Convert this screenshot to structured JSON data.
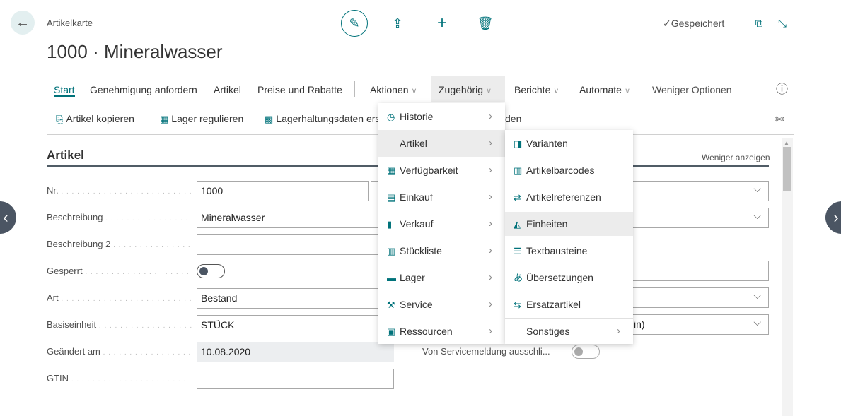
{
  "header": {
    "breadcrumb": "Artikelkarte",
    "title": "1000 · Mineralwasser",
    "status": "Gespeichert"
  },
  "tabs": [
    {
      "label": "Start"
    },
    {
      "label": "Genehmigung anfordern"
    },
    {
      "label": "Artikel"
    },
    {
      "label": "Preise und Rabatte"
    },
    {
      "label": "Aktionen"
    },
    {
      "label": "Zugehörig"
    },
    {
      "label": "Berichte"
    },
    {
      "label": "Automate"
    },
    {
      "label": "Weniger Optionen"
    }
  ],
  "actions": [
    {
      "label": "Artikel kopieren"
    },
    {
      "label": "Lager regulieren"
    },
    {
      "label": "Lagerhaltungsdaten ers"
    },
    {
      "label": "den"
    }
  ],
  "section": {
    "title": "Artikel",
    "toggle": "Weniger anzeigen"
  },
  "fields": [
    {
      "label": "Nr.",
      "value": "1000"
    },
    {
      "label": "Beschreibung",
      "value": "Mineralwasser"
    },
    {
      "label": "Beschreibung 2",
      "value": ""
    },
    {
      "label": "Gesperrt",
      "value": false
    },
    {
      "label": "Art",
      "value": "Bestand"
    },
    {
      "label": "Basiseinheit",
      "value": "STÜCK"
    },
    {
      "label": "Geändert am",
      "value": "10.08.2020"
    },
    {
      "label": "GTIN",
      "value": ""
    }
  ],
  "right_fields": {
    "partial_value": "in)",
    "service_label": "Von Servicemeldung ausschli...",
    "service_value": false
  },
  "menu": [
    {
      "label": "Historie",
      "icon": "history-icon"
    },
    {
      "label": "Artikel",
      "icon": ""
    },
    {
      "label": "Verfügbarkeit",
      "icon": "availability-icon"
    },
    {
      "label": "Einkauf",
      "icon": "purchase-icon"
    },
    {
      "label": "Verkauf",
      "icon": "sales-icon"
    },
    {
      "label": "Stückliste",
      "icon": "bom-icon"
    },
    {
      "label": "Lager",
      "icon": "warehouse-icon"
    },
    {
      "label": "Service",
      "icon": "service-icon"
    },
    {
      "label": "Ressourcen",
      "icon": "resources-icon"
    }
  ],
  "submenu": [
    {
      "label": "Varianten",
      "icon": "variants-icon"
    },
    {
      "label": "Artikelbarcodes",
      "icon": "barcode-icon"
    },
    {
      "label": "Artikelreferenzen",
      "icon": "swap-icon"
    },
    {
      "label": "Einheiten",
      "icon": "units-icon"
    },
    {
      "label": "Textbausteine",
      "icon": "text-icon"
    },
    {
      "label": "Übersetzungen",
      "icon": "translate-icon"
    },
    {
      "label": "Ersatzartikel",
      "icon": "substitute-icon"
    },
    {
      "label": "Sonstiges",
      "icon": ""
    }
  ],
  "colors": {
    "accent": "#00727a",
    "highlight": "#ececec"
  }
}
